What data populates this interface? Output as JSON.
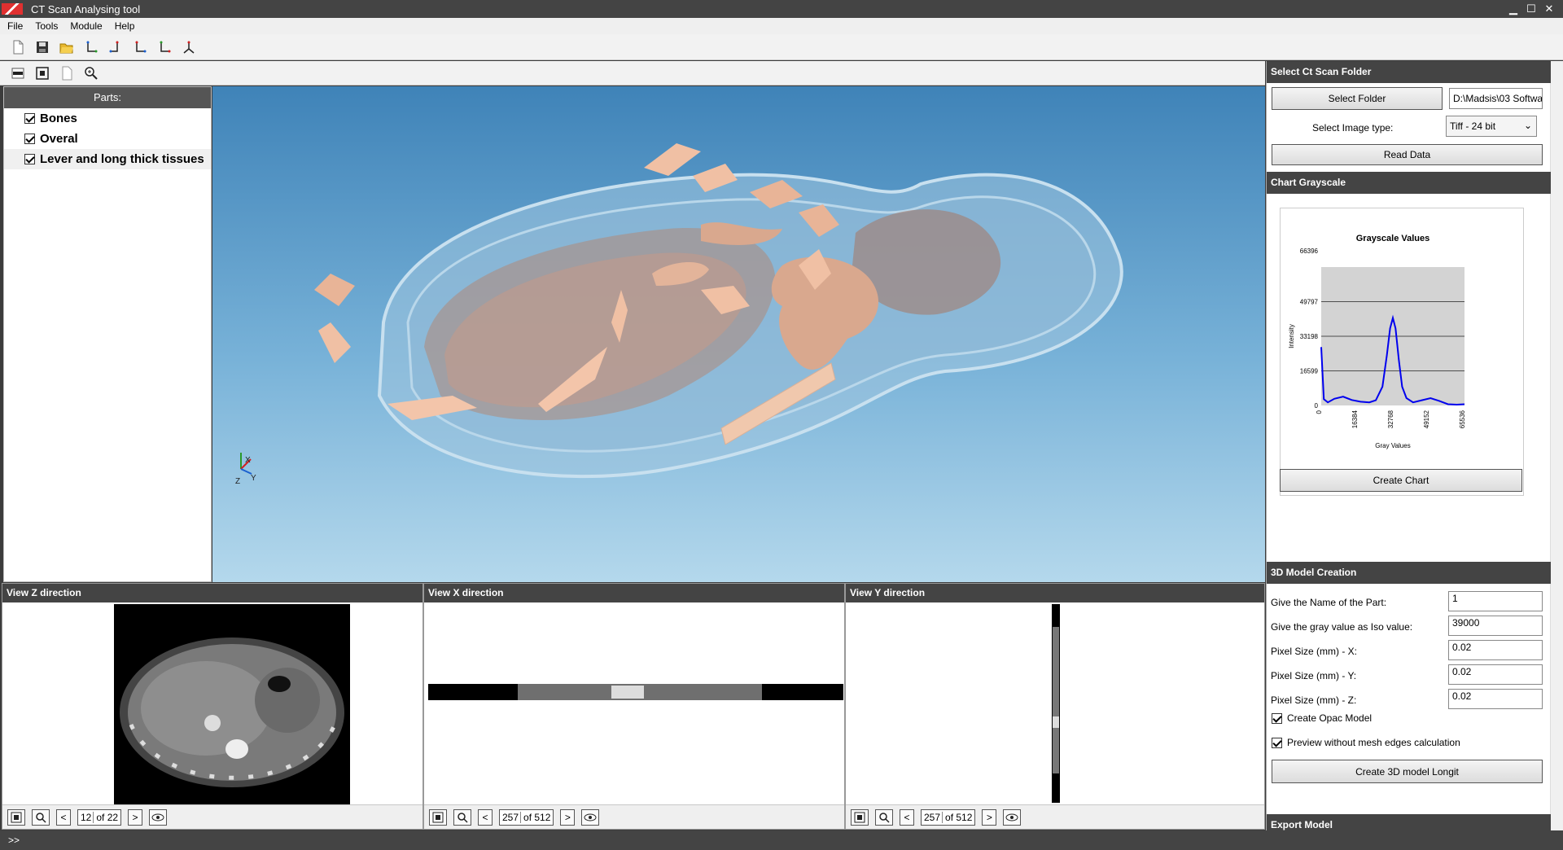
{
  "window": {
    "title": "CT Scan Analysing tool",
    "minimize": "▁",
    "maximize": "☐",
    "close": "✕"
  },
  "menu": [
    "File",
    "Tools",
    "Module",
    "Help"
  ],
  "toolbar": {
    "icons": [
      "new-file-icon",
      "save-icon",
      "open-folder-icon",
      "axis-view-1-icon",
      "axis-view-2-icon",
      "axis-view-3-icon",
      "axis-view-4-icon",
      "axis-view-5-icon"
    ]
  },
  "view_toolbar": {
    "icons": [
      "minus-icon",
      "fit-view-icon",
      "blank-page-icon",
      "zoom-icon"
    ]
  },
  "parts": {
    "header": "Parts:",
    "items": [
      {
        "label": "Bones",
        "checked": true
      },
      {
        "label": "Overal",
        "checked": true
      },
      {
        "label": "Lever and long thick tissues",
        "checked": true
      }
    ]
  },
  "viewport": {
    "axis_labels": {
      "x": "X",
      "y": "Y",
      "z": "Z"
    },
    "background_top": "#3f83b8",
    "background_bottom": "#b4d8ec"
  },
  "slices": [
    {
      "title": "View Z direction",
      "current": "12",
      "total": "of 22"
    },
    {
      "title": "View X direction",
      "current": "257",
      "total": "of 512"
    },
    {
      "title": "View Y direction",
      "current": "257",
      "total": "of 512"
    }
  ],
  "slice_nav": {
    "prev": "<",
    "next": ">"
  },
  "ct_folder": {
    "header": "Select Ct Scan Folder",
    "select_folder": "Select Folder",
    "folder_path": "D:\\Madsis\\03 Softwa",
    "image_type_label": "Select Image type:",
    "image_type_value": "Tiff - 24 bit",
    "read_data": "Read Data"
  },
  "grayscale": {
    "header": "Chart Grayscale",
    "create_chart": "Create Chart"
  },
  "chart_data": {
    "type": "line",
    "title": "Grayscale Values",
    "xlabel": "Gray Values",
    "ylabel": "Intensity",
    "yticks": [
      "66396",
      "49797",
      "33198",
      "16599",
      "0"
    ],
    "xticks": [
      "0",
      "16384",
      "32768",
      "49152",
      "65536"
    ],
    "ylim": [
      0,
      66396
    ],
    "xlim": [
      0,
      65536
    ],
    "series": [
      {
        "color": "#0000ee",
        "x": [
          0,
          1200,
          3000,
          6000,
          10000,
          14000,
          18000,
          22000,
          25000,
          28000,
          30000,
          31500,
          32768,
          34000,
          35500,
          37000,
          39000,
          42000,
          46000,
          50000,
          54000,
          58000,
          62000,
          65536
        ],
        "y": [
          28000,
          3000,
          1500,
          3200,
          4200,
          2600,
          1800,
          1500,
          2500,
          9000,
          24000,
          37000,
          42000,
          37000,
          22000,
          9000,
          3500,
          1500,
          2500,
          3500,
          2200,
          600,
          400,
          600
        ]
      }
    ]
  },
  "model_creation": {
    "header": "3D Model Creation",
    "part_name_label": "Give the Name of the Part:",
    "part_name_value": "1",
    "iso_label": "Give the gray value as Iso value:",
    "iso_value": "39000",
    "px_x_label": "Pixel Size (mm) - X:",
    "px_x_value": "0.02",
    "px_y_label": "Pixel Size (mm) - Y:",
    "px_y_value": "0.02",
    "px_z_label": "Pixel Size (mm) - Z:",
    "px_z_value": "0.02",
    "opac_label": "Create Opac Model",
    "preview_label": "Preview without mesh edges calculation",
    "create_button": "Create 3D model Longit"
  },
  "export": {
    "header": "Export Model"
  },
  "status": {
    "text": ">>"
  }
}
